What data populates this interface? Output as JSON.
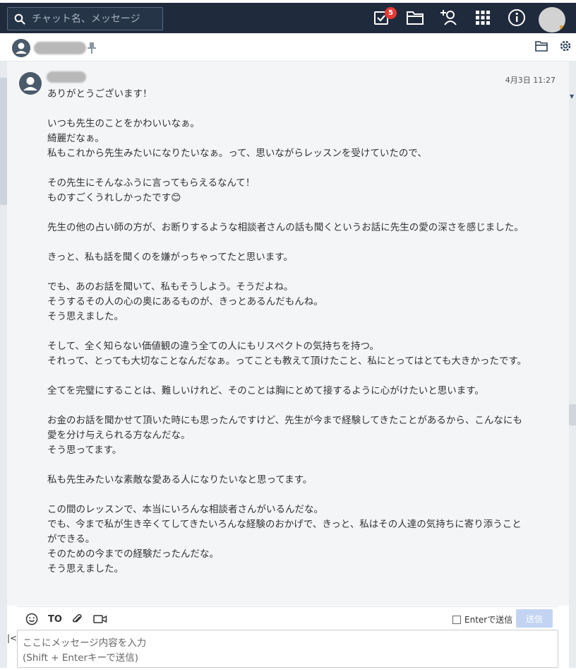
{
  "header": {
    "search_placeholder": "チャット名、メッセージ",
    "task_badge_count": "5",
    "icons": [
      "search-icon",
      "task-check-icon",
      "folder-icon",
      "add-contact-icon",
      "apps-grid-icon",
      "info-icon",
      "user-avatar"
    ]
  },
  "room": {
    "name": "",
    "icons": [
      "room-avatar-icon",
      "pin-icon",
      "folder-icon",
      "settings-gear-icon"
    ]
  },
  "message": {
    "sender": "",
    "timestamp": "4月3日 11:27",
    "lines": [
      "ありがとうございます！",
      "",
      "いつも先生のことをかわいいなぁ。",
      "綺麗だなぁ。",
      "私もこれから先生みたいになりたいなぁ。って、思いながらレッスンを受けていたので、",
      "",
      "その先生にそんなふうに言ってもらえるなんて！",
      "ものすごくうれしかったです😊",
      "",
      "先生の他の占い師の方が、お断りするような相談者さんの話も聞くというお話に先生の愛の深さを感じました。",
      "",
      "きっと、私も話を聞くのを嫌がっちゃってたと思います。",
      "",
      "でも、あのお話を聞いて、私もそうしよう。そうだよね。",
      "そうするその人の心の奥にあるものが、きっとあるんだもんね。",
      "そう思えました。",
      "",
      "そして、全く知らない価値観の違う全ての人にもリスペクトの気持ちを持つ。",
      "それって、とっても大切なことなんだなぁ。ってことも教えて頂けたこと、私にとってはとても大きかったです。",
      "",
      "全てを完璧にすることは、難しいけれど、そのことは胸にとめて接するように心がけたいと思います。",
      "",
      "お金のお話を聞かせて頂いた時にも思ったんですけど、先生が今まで経験してきたことがあるから、こんなにも愛を分け与えられる方なんだな。",
      "そう思ってます。",
      "",
      "私も先生みたいな素敵な愛ある人になりたいなと思ってます。",
      "",
      "この間のレッスンで、本当にいろんな相談者さんがいるんだな。",
      "でも、今まで私が生き辛くてしてきたいろんな経験のおかげで、きっと、私はその人達の気持ちに寄り添うことができる。",
      "そのための今までの経験だったんだな。",
      "そう思えました。"
    ]
  },
  "composer": {
    "to_label": "TO",
    "enter_send_label": "Enterで送信",
    "send_label": "送信",
    "placeholder": "ここにメッセージ内容を入力\n(Shift + Enterキーで送信)",
    "icons": [
      "emoji-icon",
      "attach-clip-icon",
      "video-call-icon",
      "collapse-icon"
    ]
  },
  "colors": {
    "topbar": "#1f2a3d",
    "timeline_bg": "#f4f5f7",
    "send_disabled": "#c3d4f3",
    "badge": "#e53935"
  }
}
